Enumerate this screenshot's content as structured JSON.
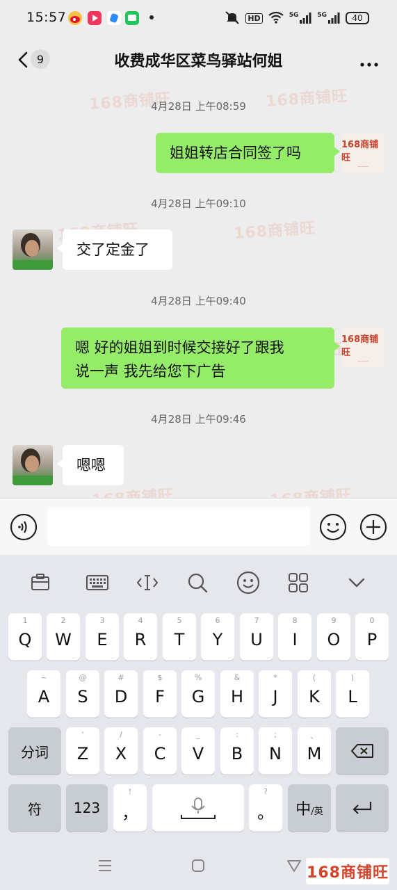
{
  "status": {
    "time": "15:57",
    "hd": "HD",
    "sim1": "5G",
    "sim2": "5G",
    "battery": "40"
  },
  "header": {
    "unread_count": "9",
    "title": "收费成华区菜鸟驿站何姐"
  },
  "watermark": "168商铺旺",
  "messages": [
    {
      "timestamp": "4月28日 上午08:59",
      "side": "right",
      "text": "姐姐转店合同签了吗"
    },
    {
      "timestamp": "4月28日 上午09:10",
      "side": "left",
      "text": "交了定金了"
    },
    {
      "timestamp": "4月28日 上午09:40",
      "side": "right",
      "lines": [
        "嗯 好的姐姐到时候交接好了跟我",
        "说一声 我先给您下广告"
      ]
    },
    {
      "timestamp": "4月28日 上午09:46",
      "side": "left",
      "text": "嗯嗯"
    }
  ],
  "my_avatar_brand": "168商铺旺",
  "input": {
    "placeholder": ""
  },
  "keyboard": {
    "row1": [
      {
        "k": "Q",
        "h": "1"
      },
      {
        "k": "W",
        "h": "2"
      },
      {
        "k": "E",
        "h": "3"
      },
      {
        "k": "R",
        "h": "4"
      },
      {
        "k": "T",
        "h": "5"
      },
      {
        "k": "Y",
        "h": "6"
      },
      {
        "k": "U",
        "h": "7"
      },
      {
        "k": "I",
        "h": "8"
      },
      {
        "k": "O",
        "h": "9"
      },
      {
        "k": "P",
        "h": "0"
      }
    ],
    "row2": [
      {
        "k": "A",
        "h": "~"
      },
      {
        "k": "S",
        "h": "@"
      },
      {
        "k": "D",
        "h": "#"
      },
      {
        "k": "F",
        "h": "$"
      },
      {
        "k": "G",
        "h": "%"
      },
      {
        "k": "H",
        "h": "&"
      },
      {
        "k": "J",
        "h": "*"
      },
      {
        "k": "K",
        "h": "("
      },
      {
        "k": "L",
        "h": ")"
      }
    ],
    "row3": [
      {
        "k": "Z",
        "h": "'"
      },
      {
        "k": "X",
        "h": "/"
      },
      {
        "k": "C",
        "h": "-"
      },
      {
        "k": "V",
        "h": "_"
      },
      {
        "k": "B",
        "h": ":"
      },
      {
        "k": "N",
        "h": ";"
      },
      {
        "k": "M",
        "h": "、"
      }
    ],
    "segment_key": "分词",
    "symbol_key": "符",
    "numbers_key": "123",
    "comma_key": {
      "k": "，",
      "h": "!"
    },
    "period_key": {
      "k": "。",
      "h": "?"
    },
    "lang_key_main": "中",
    "lang_key_sub": "/英"
  },
  "corner_watermark": "168商铺旺"
}
